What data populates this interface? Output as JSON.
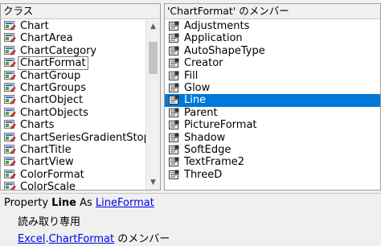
{
  "left_pane": {
    "title": "クラス",
    "items": [
      "Chart",
      "ChartArea",
      "ChartCategory",
      "ChartFormat",
      "ChartGroup",
      "ChartGroups",
      "ChartObject",
      "ChartObjects",
      "Charts",
      "ChartSeriesGradientStopData",
      "ChartTitle",
      "ChartView",
      "ColorFormat",
      "ColorScale"
    ],
    "selected": "ChartFormat"
  },
  "right_pane": {
    "title": "'ChartFormat' のメンバー",
    "items": [
      "Adjustments",
      "Application",
      "AutoShapeType",
      "Creator",
      "Fill",
      "Glow",
      "Line",
      "Parent",
      "PictureFormat",
      "Shadow",
      "SoftEdge",
      "TextFrame2",
      "ThreeD"
    ],
    "selected": "Line"
  },
  "details": {
    "prefix": "Property ",
    "member": "Line",
    "as_text": " As ",
    "type_link": "LineFormat",
    "access": "読み取り専用",
    "lib_link": "Excel",
    "dot": ".",
    "class_link": "ChartFormat",
    "suffix": " のメンバー"
  },
  "colors": {
    "selection": "#0078d7",
    "link": "#0000ee"
  }
}
